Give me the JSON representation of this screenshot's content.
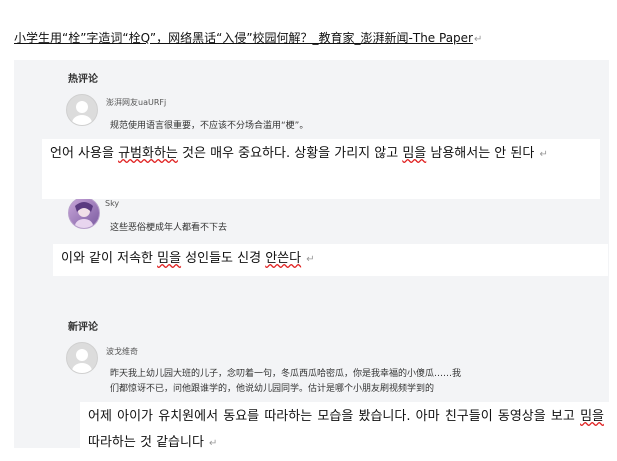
{
  "article": {
    "title": "小学生用“栓”字造词“栓Q”，网络黑话“入侵”校园何解？_教育家_澎湃新闻-The Paper",
    "para_mark": "↵"
  },
  "comments": {
    "hot_title": "热评论",
    "new_title": "新评论",
    "items": [
      {
        "user": "澎湃网友uaURFj",
        "text": "规范使用语言很重要，不应该不分场合滥用“梗”。"
      },
      {
        "user": "Sky",
        "text": "这些恶俗梗成年人都看不下去"
      },
      {
        "user": "波戈维奇",
        "text_line1": "昨天我上幼儿园大班的儿子，念叨着一句，冬瓜西瓜哈密瓜，你是我幸福的小傻瓜……我",
        "text_line2": "们都惊讶不已，问他跟谁学的，他说幼儿园同学。估计是哪个小朋友刷视频学到的"
      }
    ]
  },
  "translations": [
    {
      "segments": [
        "언어 사용을 ",
        "규범화하는",
        " 것은 매우 중요하다. 상황을 가리지 않고 ",
        "밈을",
        " 남용해서는 안 된다 "
      ]
    },
    {
      "segments": [
        "이와 같이 저속한 ",
        "밈을",
        " 성인들도 신경 ",
        "안쓴다",
        " "
      ]
    },
    {
      "segments": [
        "어제 아이가 유치원에서 동요를 따라하는 모습을 봤습니다. 아마 친구들이 동영상을 보고 ",
        "밈을",
        " 따라하는 것 같습니다 "
      ]
    }
  ]
}
